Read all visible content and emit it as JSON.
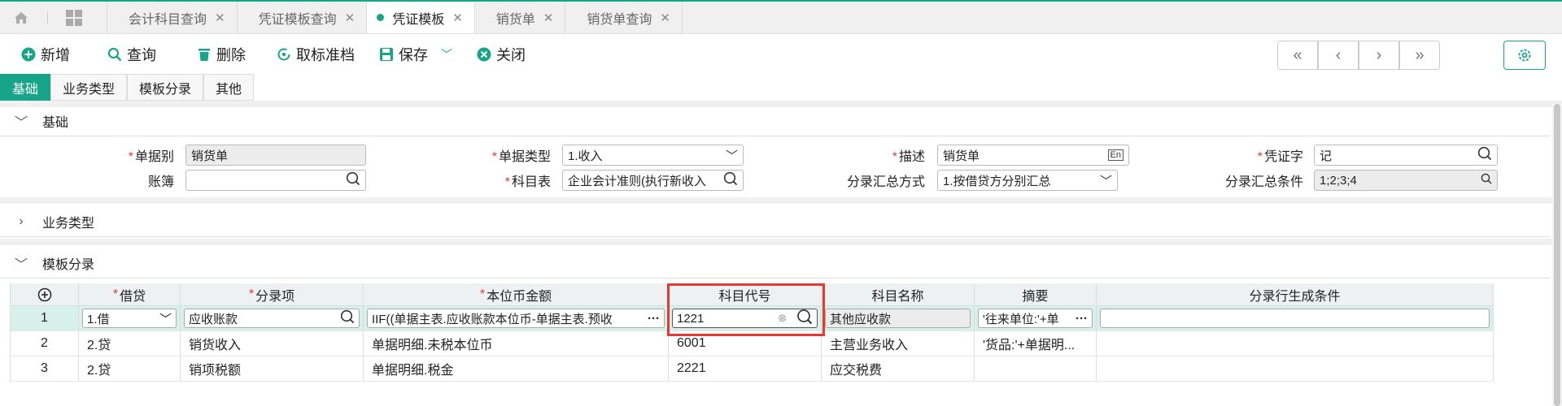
{
  "tabs": [
    {
      "label": "会计科目查询"
    },
    {
      "label": "凭证模板查询"
    },
    {
      "label": "凭证模板"
    },
    {
      "label": "销货单"
    },
    {
      "label": "销货单查询"
    }
  ],
  "toolbar": {
    "add_label": "新增",
    "query_label": "查询",
    "delete_label": "删除",
    "unarchive_label": "取标准档",
    "save_label": "保存",
    "close_label": "关闭"
  },
  "subtabs": [
    {
      "label": "基础"
    },
    {
      "label": "业务类型"
    },
    {
      "label": "模板分录"
    },
    {
      "label": "其他"
    }
  ],
  "sections": {
    "basic": "基础",
    "business_type": "业务类型",
    "template_entries": "模板分录"
  },
  "form": {
    "doc_type_label": "单据别",
    "doc_type_value": "销货单",
    "doc_category_label": "单据类型",
    "doc_category_value": "1.收入",
    "desc_label": "描述",
    "desc_value": "销货单",
    "voucher_word_label": "凭证字",
    "voucher_word_value": "记",
    "ledger_label": "账簿",
    "ledger_value": "",
    "chart_label": "科目表",
    "chart_value": "企业会计准则(执行新收入",
    "summary_method_label": "分录汇总方式",
    "summary_method_value": "1.按借贷方分别汇总",
    "summary_cond_label": "分录汇总条件",
    "summary_cond_value": "1;2;3;4"
  },
  "grid": {
    "headers": [
      "借贷",
      "分录项",
      "本位币金额",
      "科目代号",
      "科目名称",
      "摘要",
      "分录行生成条件"
    ],
    "required": [
      true,
      true,
      true,
      false,
      false,
      false,
      false
    ],
    "rows": [
      {
        "no": "1",
        "dc": "1.借",
        "item": "应收账款",
        "amount": "IIF((单据主表.应收账款本位币-单据主表.预收",
        "code": "1221",
        "name": "其他应收款",
        "memo": "'往来单位:'+单",
        "cond": ""
      },
      {
        "no": "2",
        "dc": "2.贷",
        "item": "销货收入",
        "amount": "单据明细.未税本位币",
        "code": "6001",
        "name": "主营业务收入",
        "memo": "'货品:'+单据明...",
        "cond": ""
      },
      {
        "no": "3",
        "dc": "2.贷",
        "item": "销项税额",
        "amount": "单据明细.税金",
        "code": "2221",
        "name": "应交税费",
        "memo": "",
        "cond": ""
      }
    ]
  },
  "colors": {
    "accent": "#17a589",
    "highlight": "#e53935"
  }
}
